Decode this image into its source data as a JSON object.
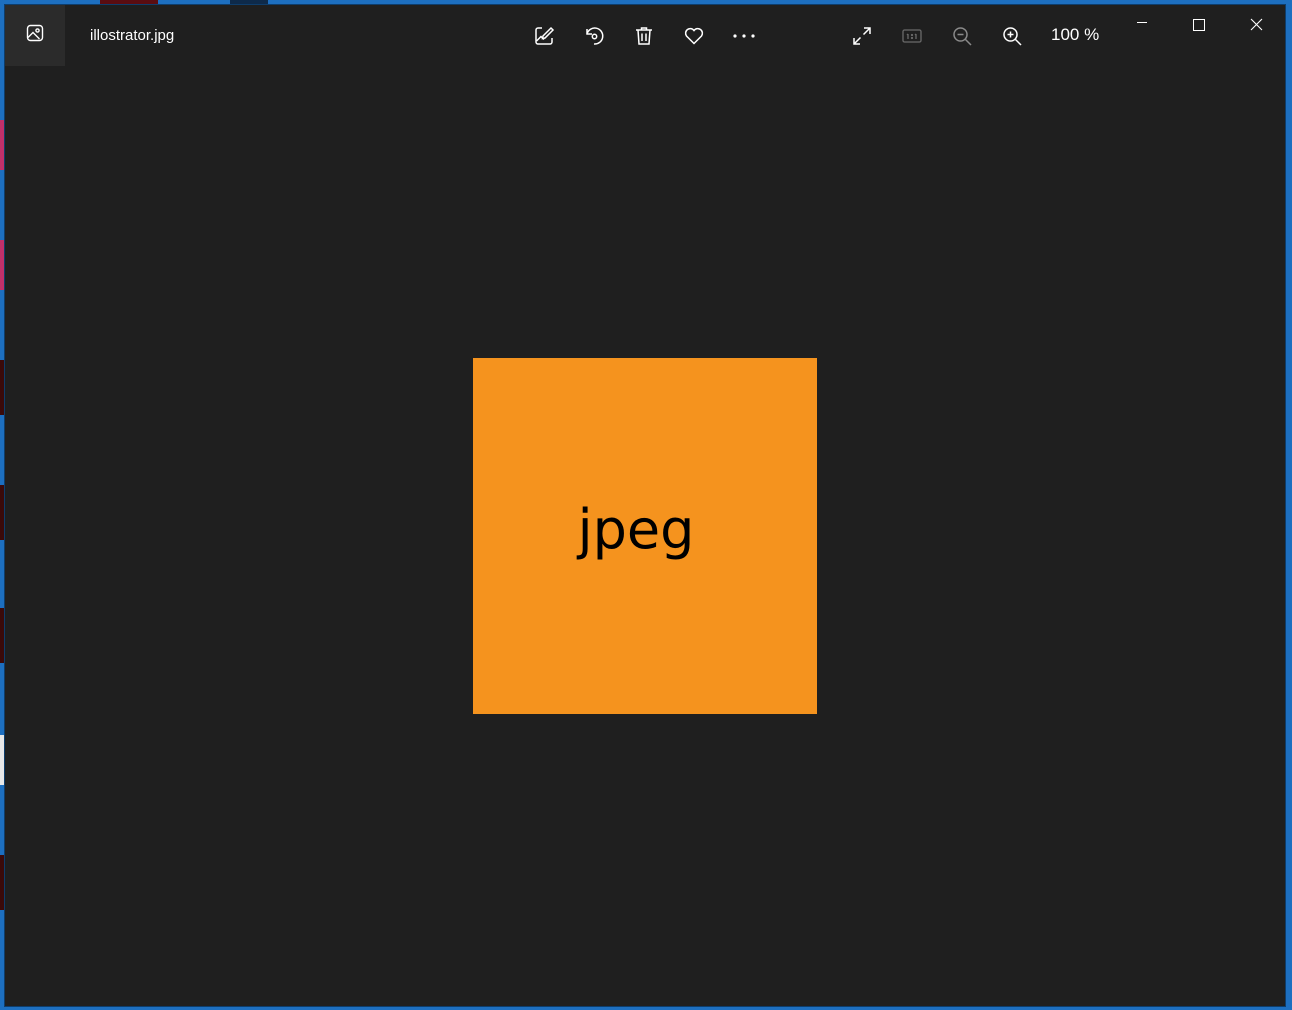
{
  "window": {
    "filename": "illostrator.jpg",
    "zoom": "100 %"
  },
  "toolbar": {
    "items": [
      {
        "name": "edit-create-icon"
      },
      {
        "name": "rotate-icon"
      },
      {
        "name": "delete-icon"
      },
      {
        "name": "favorite-heart-icon"
      },
      {
        "name": "more-options-icon"
      },
      {
        "name": "fullscreen-expand-icon"
      },
      {
        "name": "actual-size-icon"
      },
      {
        "name": "zoom-out-icon"
      },
      {
        "name": "zoom-in-icon"
      }
    ]
  },
  "image": {
    "text": "jpeg",
    "background": "#f5931e"
  },
  "colors": {
    "window_bg": "#1f1f1f",
    "foreground": "#ffffff",
    "disabled": "#6a6a6a"
  }
}
